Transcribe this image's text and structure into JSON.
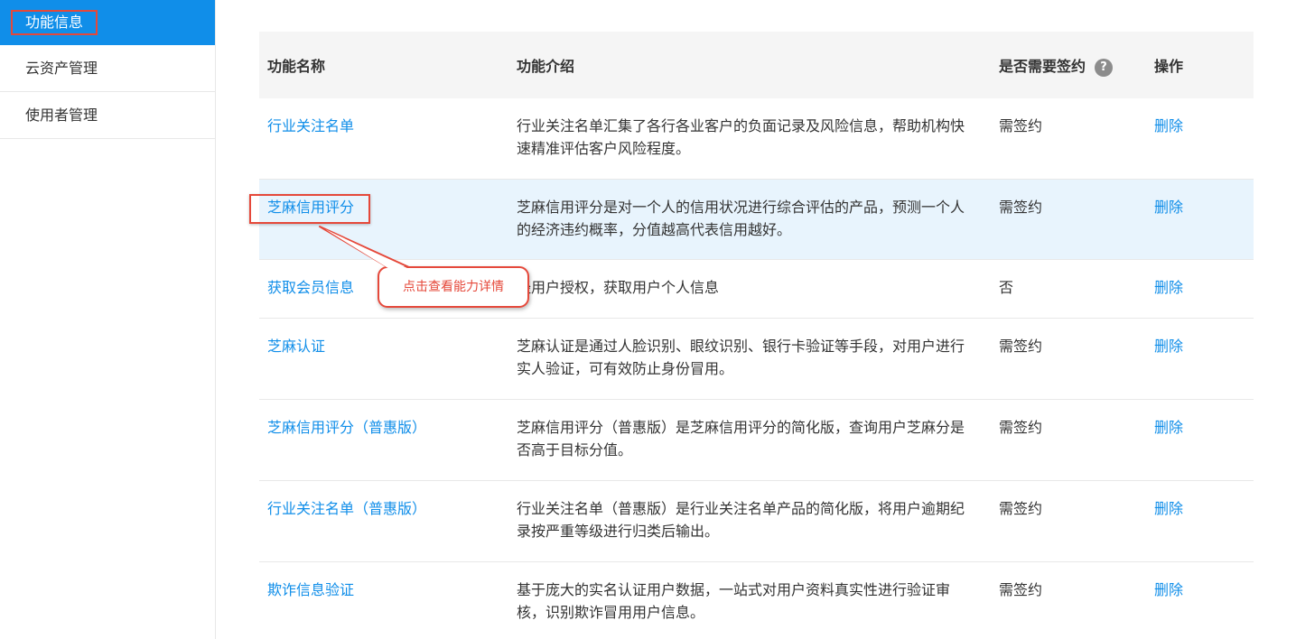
{
  "sidebar": {
    "items": [
      {
        "label": "功能信息",
        "active": true
      },
      {
        "label": "云资产管理",
        "active": false
      },
      {
        "label": "使用者管理",
        "active": false
      }
    ]
  },
  "table": {
    "headers": {
      "name": "功能名称",
      "desc": "功能介绍",
      "sign": "是否需要签约",
      "sign_help_icon": "question-circle-icon",
      "sign_help_glyph": "?",
      "op": "操作"
    },
    "rows": [
      {
        "name": "行业关注名单",
        "desc_lines": [
          "行业关注名单汇集了各行各业客户的负面记录及风险信息，帮助机构快",
          "速精准评估客户风险程度。"
        ],
        "sign": "需签约",
        "op": "删除"
      },
      {
        "name": "芝麻信用评分",
        "desc_lines": [
          "芝麻信用评分是对一个人的信用状况进行综合评估的产品，预测一个人",
          "的经济违约概率，分值越高代表信用越好。"
        ],
        "sign": "需签约",
        "op": "删除"
      },
      {
        "name": "获取会员信息",
        "desc_lines": [
          "经用户授权，获取用户个人信息"
        ],
        "sign": "否",
        "op": "删除"
      },
      {
        "name": "芝麻认证",
        "desc_lines": [
          "芝麻认证是通过人脸识别、眼纹识别、银行卡验证等手段，对用户进行",
          "实人验证，可有效防止身份冒用。"
        ],
        "sign": "需签约",
        "op": "删除"
      },
      {
        "name": "芝麻信用评分（普惠版）",
        "desc_lines": [
          "芝麻信用评分（普惠版）是芝麻信用评分的简化版，查询用户芝麻分是",
          "否高于目标分值。"
        ],
        "sign": "需签约",
        "op": "删除"
      },
      {
        "name": "行业关注名单（普惠版）",
        "desc_lines": [
          "行业关注名单（普惠版）是行业关注名单产品的简化版，将用户逾期纪",
          "录按严重等级进行归类后输出。"
        ],
        "sign": "需签约",
        "op": "删除"
      },
      {
        "name": "欺诈信息验证",
        "desc_lines": [
          "基于庞大的实名认证用户数据，一站式对用户资料真实性进行验证审",
          "核，识别欺诈冒用用户信息。"
        ],
        "sign": "需签约",
        "op": "删除"
      }
    ]
  },
  "callout": {
    "text": "点击查看能力详情"
  },
  "colors": {
    "accent": "#108ee9",
    "annotation": "#e5483a",
    "row_highlight": "#e8f4fd",
    "header_bg": "#f5f5f5"
  }
}
